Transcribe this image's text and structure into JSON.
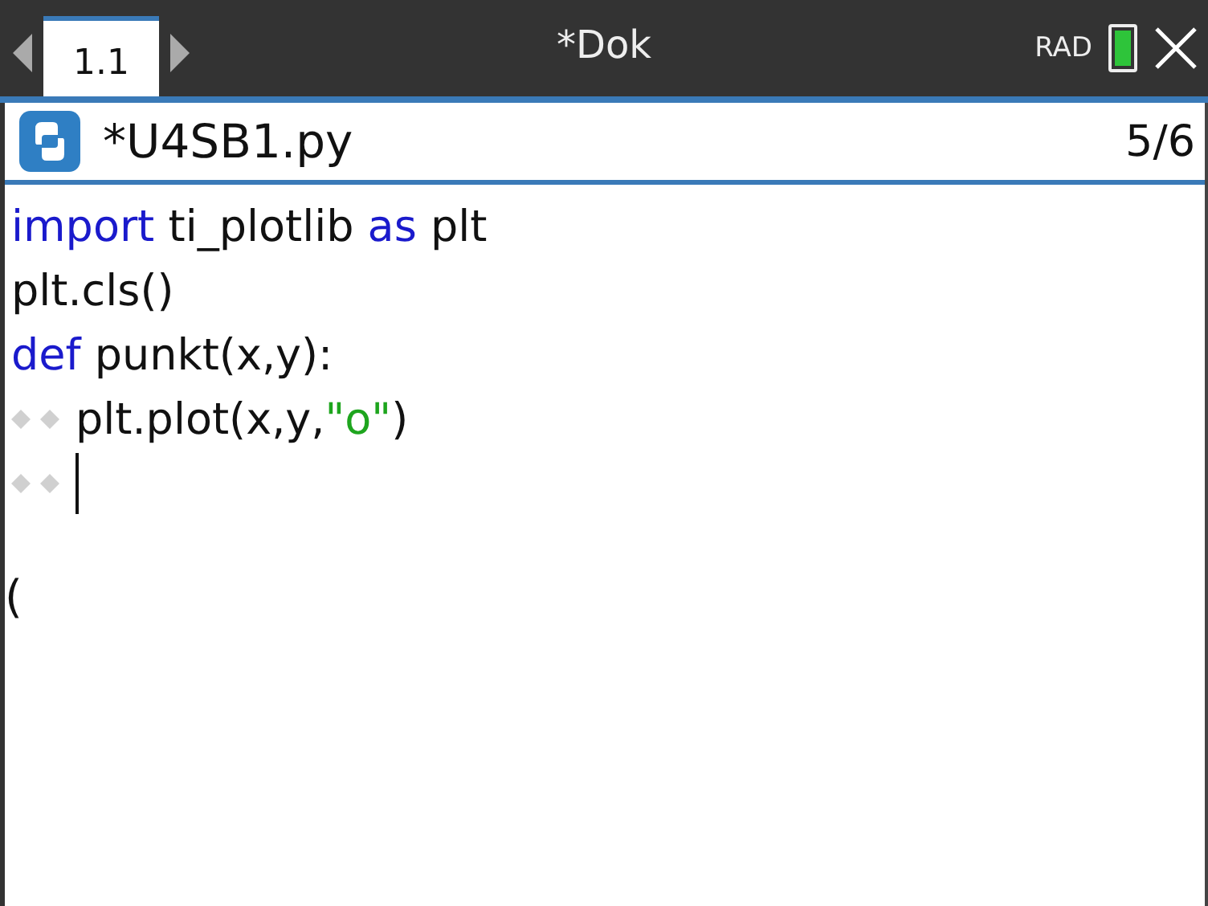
{
  "top_bar": {
    "tabs": [
      {
        "label": "1.1",
        "selected": true
      }
    ],
    "title": "*Dok",
    "angle_mode": "RAD"
  },
  "editor": {
    "file_name": "*U4SB1.py",
    "page": "5/6",
    "lines": [
      {
        "indented": false,
        "cursor": false,
        "tokens": [
          {
            "kind": "keyword",
            "text": "import"
          },
          {
            "kind": "plain",
            "text": " ti_plotlib "
          },
          {
            "kind": "keyword",
            "text": "as"
          },
          {
            "kind": "plain",
            "text": " plt"
          }
        ]
      },
      {
        "indented": false,
        "cursor": false,
        "tokens": [
          {
            "kind": "plain",
            "text": "plt.cls()"
          }
        ]
      },
      {
        "indented": false,
        "cursor": false,
        "tokens": [
          {
            "kind": "keyword",
            "text": "def"
          },
          {
            "kind": "plain",
            "text": " punkt(x,y):"
          }
        ]
      },
      {
        "indented": true,
        "cursor": false,
        "tokens": [
          {
            "kind": "plain",
            "text": "plt.plot(x,y,"
          },
          {
            "kind": "string",
            "text": "\"o\""
          },
          {
            "kind": "plain",
            "text": ")"
          }
        ]
      },
      {
        "indented": true,
        "cursor": true
      }
    ],
    "edge_mark": "("
  }
}
